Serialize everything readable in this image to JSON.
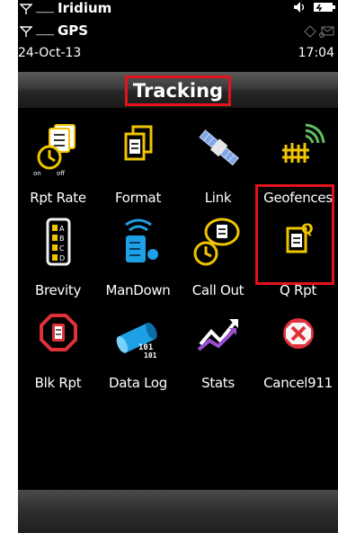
{
  "status": {
    "row1_label": "Iridium",
    "row1_signal": "____",
    "row2_label": "GPS",
    "row2_signal": "____",
    "date": "24-Oct-13",
    "time": "17:04"
  },
  "header": {
    "title": "Tracking"
  },
  "grid": [
    {
      "label": "Rpt Rate",
      "icon": "report-rate-icon"
    },
    {
      "label": "Format",
      "icon": "format-icon"
    },
    {
      "label": "Link",
      "icon": "satellite-link-icon"
    },
    {
      "label": "Geofences",
      "icon": "geofence-icon"
    },
    {
      "label": "Brevity",
      "icon": "brevity-icon"
    },
    {
      "label": "ManDown",
      "icon": "man-down-icon"
    },
    {
      "label": "Call Out",
      "icon": "call-out-icon"
    },
    {
      "label": "Q Rpt",
      "icon": "quick-report-icon"
    },
    {
      "label": "Blk Rpt",
      "icon": "block-report-icon"
    },
    {
      "label": "Data Log",
      "icon": "data-log-icon"
    },
    {
      "label": "Stats",
      "icon": "stats-icon"
    },
    {
      "label": "Cancel911",
      "icon": "cancel-911-icon"
    }
  ],
  "colors": {
    "highlight": "#e4131b",
    "accent_yellow": "#f0c400",
    "accent_blue": "#1ea0e6",
    "accent_red": "#e0303a"
  }
}
